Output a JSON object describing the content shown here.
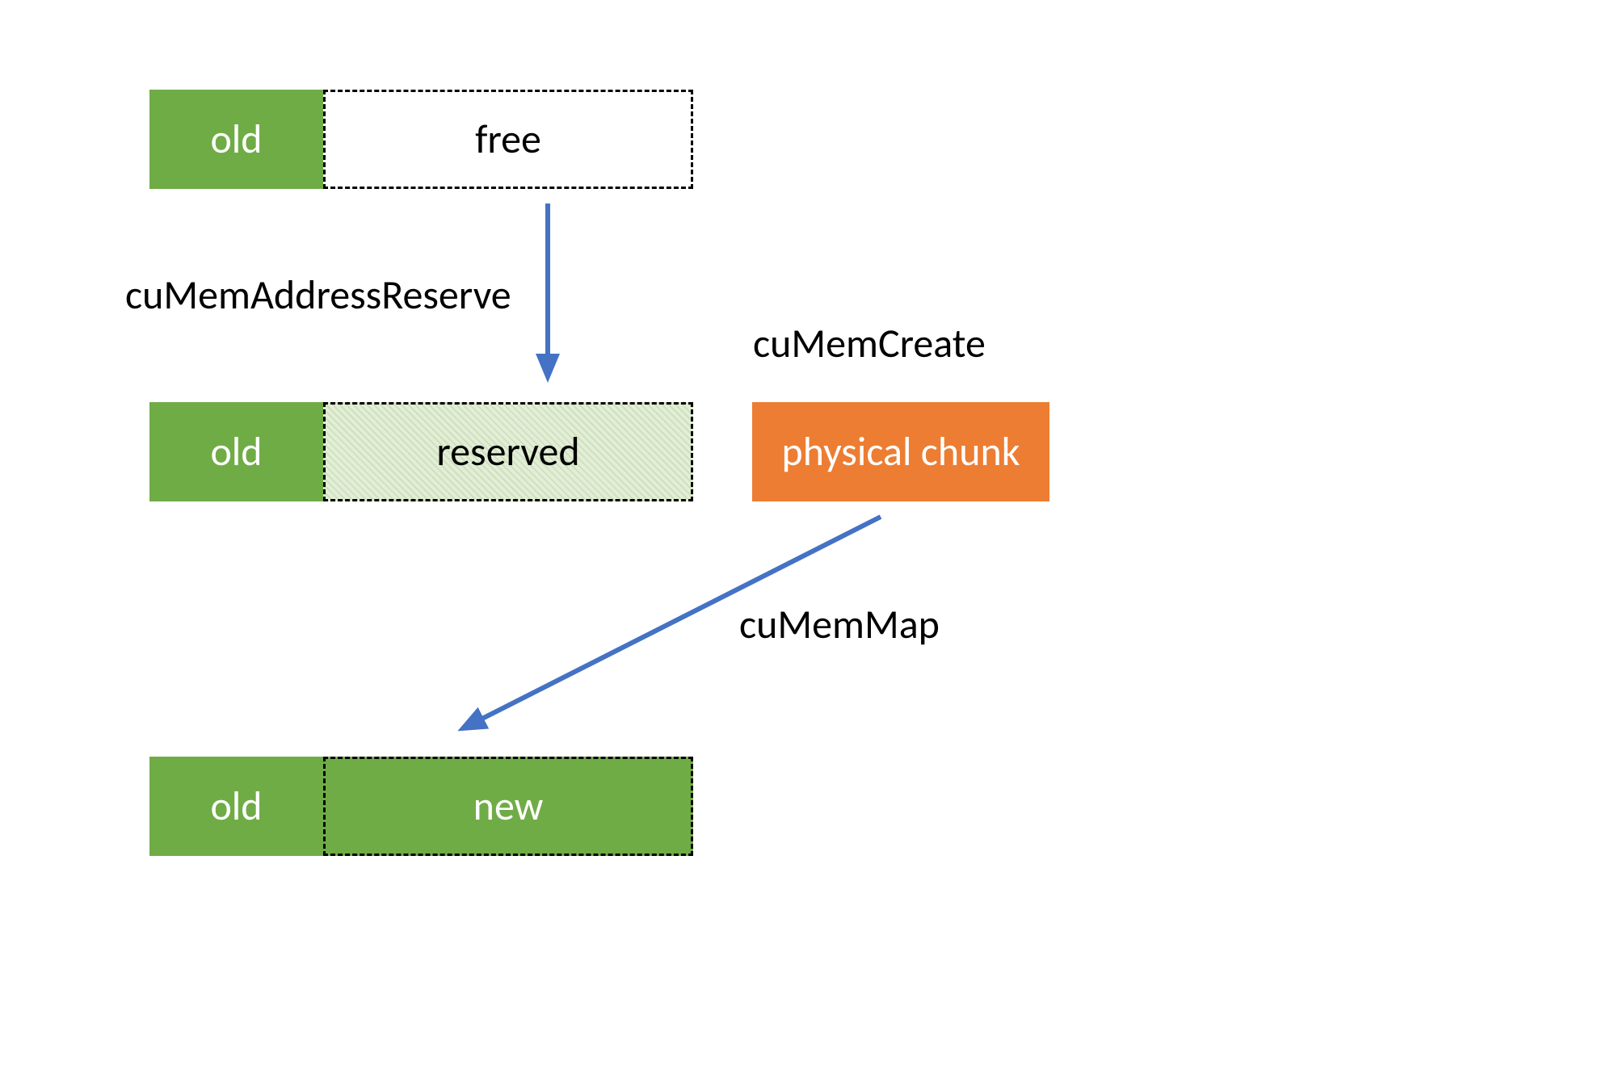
{
  "labels": {
    "old1": "old",
    "free": "free",
    "reserve_label": "cuMemAddressReserve",
    "old2": "old",
    "reserved": "reserved",
    "create_label": "cuMemCreate",
    "physical_chunk": "physical chunk",
    "map_label": "cuMemMap",
    "old3": "old",
    "new_label": "new"
  },
  "colors": {
    "green": "#6fac46",
    "orange": "#ed7d32",
    "arrow": "#4472c4"
  }
}
